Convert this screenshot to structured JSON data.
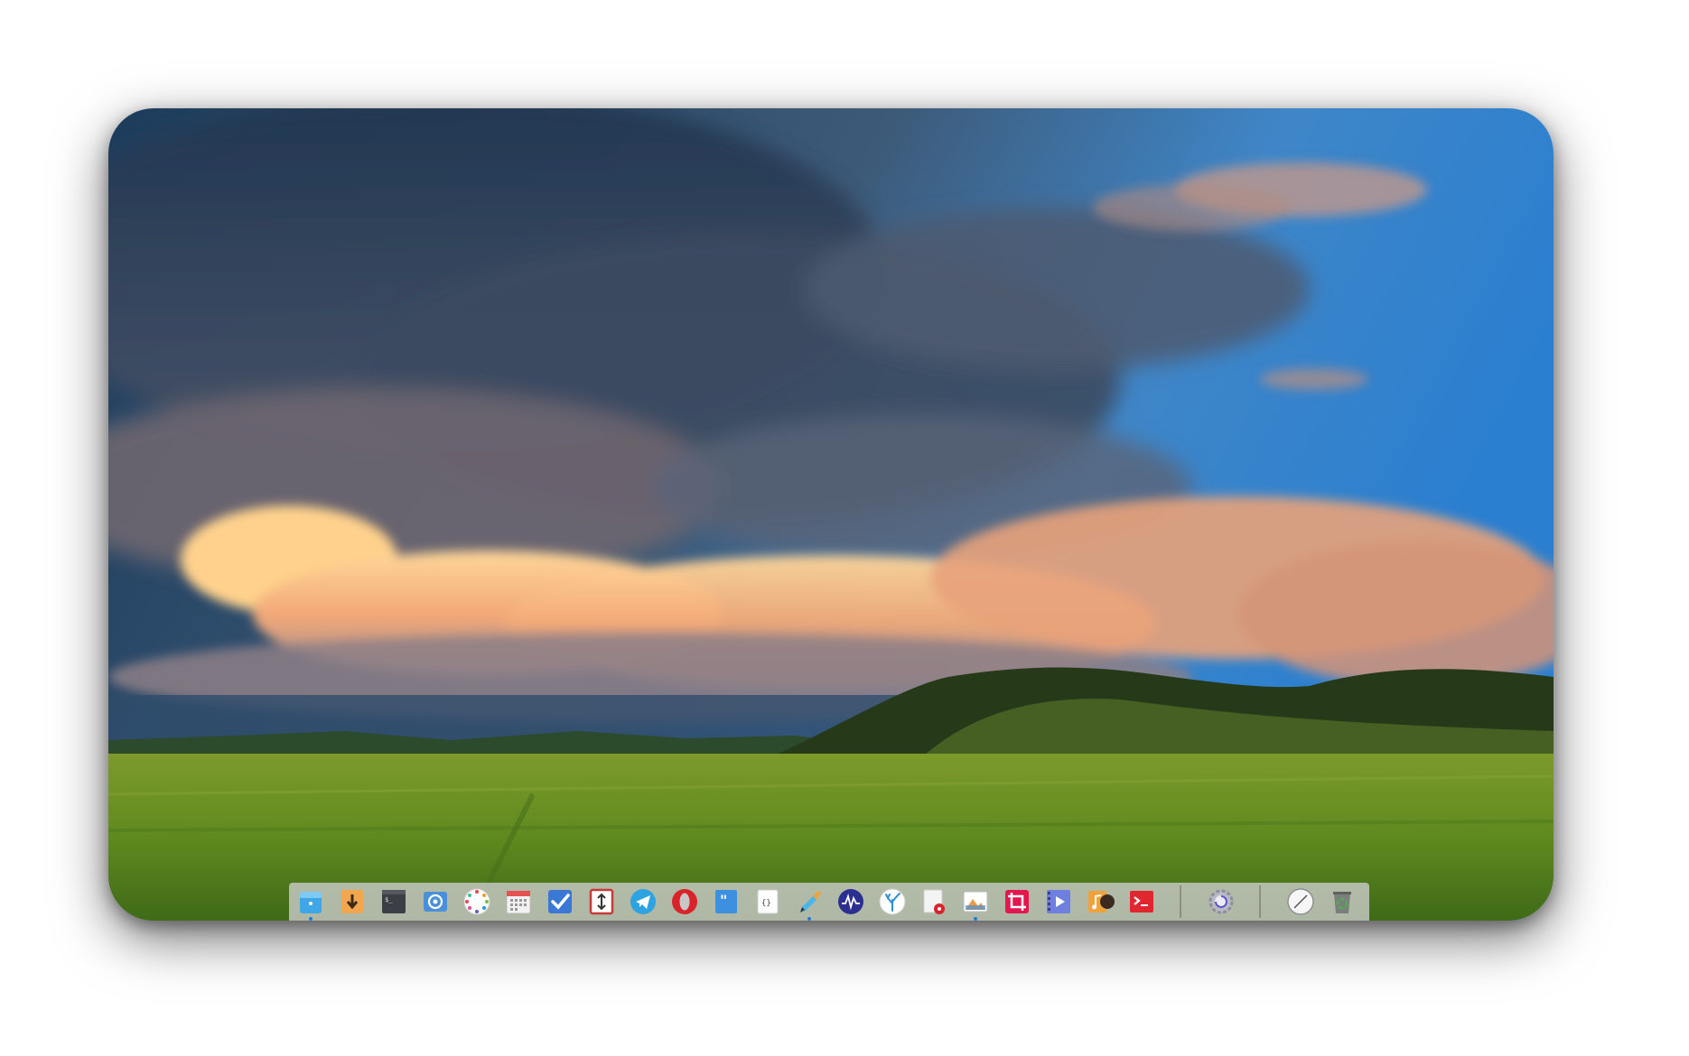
{
  "desktop": {
    "wallpaper": "grassland-sunset",
    "colors": {
      "sky": "#3f86c8",
      "cloud_glow": "#f7b274",
      "grass": "#6b8f22",
      "dock_bg": "#cecece"
    }
  },
  "dock": {
    "apps": [
      {
        "icon": "file-manager-icon",
        "running": true
      },
      {
        "icon": "download-manager-icon",
        "running": false
      },
      {
        "icon": "terminal-icon",
        "running": false
      },
      {
        "icon": "mail-icon",
        "running": false
      },
      {
        "icon": "launcher-dots-icon",
        "running": false
      },
      {
        "icon": "calendar-icon",
        "running": false
      },
      {
        "icon": "tasks-check-icon",
        "running": false
      },
      {
        "icon": "transfer-icon",
        "running": false
      },
      {
        "icon": "telegram-icon",
        "running": false
      },
      {
        "icon": "opera-icon",
        "running": false
      },
      {
        "icon": "quotes-icon",
        "running": false
      },
      {
        "icon": "code-editor-icon",
        "running": false
      },
      {
        "icon": "color-picker-icon",
        "running": true
      },
      {
        "icon": "audio-waveform-icon",
        "running": false
      },
      {
        "icon": "coral-icon",
        "running": false
      },
      {
        "icon": "document-viewer-icon",
        "running": false
      },
      {
        "icon": "image-viewer-icon",
        "running": true
      },
      {
        "icon": "crop-tool-icon",
        "running": false
      },
      {
        "icon": "video-player-icon",
        "running": false
      },
      {
        "icon": "music-player-icon",
        "running": false
      },
      {
        "icon": "console-icon",
        "running": false
      }
    ],
    "system": [
      {
        "icon": "settings-gear-icon",
        "running": false
      }
    ],
    "tray": [
      {
        "icon": "safari-compass-icon",
        "running": false
      },
      {
        "icon": "trash-icon",
        "running": false
      }
    ]
  }
}
